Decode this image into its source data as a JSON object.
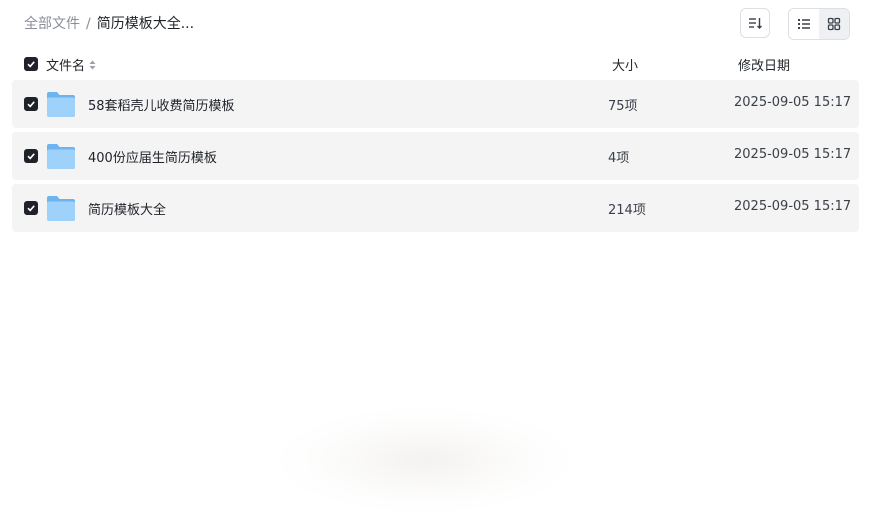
{
  "breadcrumb": {
    "root": "全部文件",
    "separator": "/",
    "current": "简历模板大全..."
  },
  "toolbar": {
    "sort_icon": "sort-icon",
    "list_view_icon": "list-view-icon",
    "grid_view_icon": "grid-view-icon"
  },
  "table": {
    "headers": {
      "name": "文件名",
      "size": "大小",
      "date": "修改日期"
    },
    "rows": [
      {
        "name": "58套稻壳儿收费简历模板",
        "size": "75项",
        "date": "2025-09-05 15:17"
      },
      {
        "name": "400份应届生简历模板",
        "size": "4项",
        "date": "2025-09-05 15:17"
      },
      {
        "name": "简历模板大全",
        "size": "214项",
        "date": "2025-09-05 15:17"
      }
    ]
  },
  "colors": {
    "row_bg": "#f4f4f5",
    "folder": "#7fc1f5",
    "checkbox": "#1f2329"
  }
}
